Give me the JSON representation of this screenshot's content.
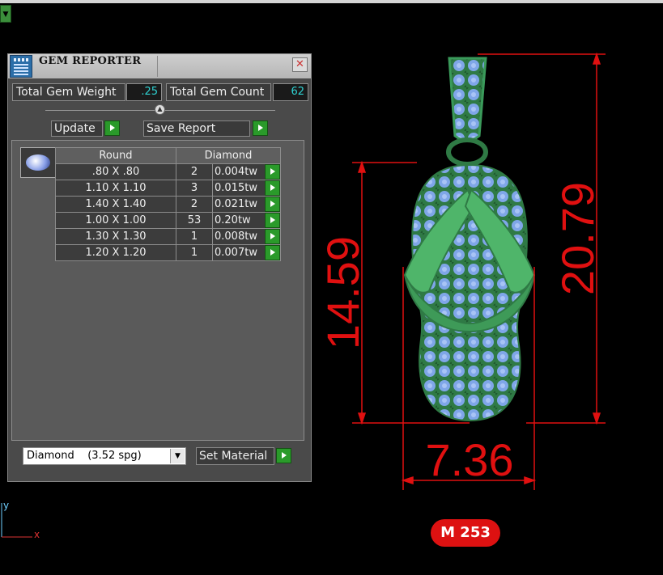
{
  "app": {
    "window_title": "GEM REPORTER",
    "close_glyph": "✕"
  },
  "stats": {
    "weight_label": "Total Gem Weight",
    "weight_value": ".25",
    "count_label": "Total Gem Count",
    "count_value": "62"
  },
  "actions": {
    "update_label": "Update",
    "save_report_label": "Save Report"
  },
  "gem_table": {
    "headers": [
      "Round",
      "Diamond"
    ],
    "rows": [
      {
        "size": ".80 X .80",
        "count": "2",
        "weight": "0.004tw"
      },
      {
        "size": "1.10 X 1.10",
        "count": "3",
        "weight": "0.015tw"
      },
      {
        "size": "1.40 X 1.40",
        "count": "2",
        "weight": "0.021tw"
      },
      {
        "size": "1.00 X 1.00",
        "count": "53",
        "weight": "0.20tw"
      },
      {
        "size": "1.30 X 1.30",
        "count": "1",
        "weight": "0.008tw"
      },
      {
        "size": "1.20 X 1.20",
        "count": "1",
        "weight": "0.007tw"
      }
    ]
  },
  "material": {
    "selected": "Diamond    (3.52 spg)",
    "set_material_label": "Set Material"
  },
  "viewport": {
    "dim_height": "14.59",
    "dim_total_height": "20.79",
    "dim_width": "7.36",
    "axis_x": "x",
    "axis_y": "y",
    "model_code": "M 253"
  },
  "colors": {
    "dimension": "#e01010",
    "metal": "#3a9a5a",
    "gems": "#7fa6e8",
    "accent_cyan": "#2fd3d3"
  },
  "icons": {
    "corner": "dropdown-arrow-icon",
    "app": "gem-reporter-icon",
    "close": "close-icon",
    "go": "play-arrow-icon",
    "gem": "round-gem-icon"
  }
}
